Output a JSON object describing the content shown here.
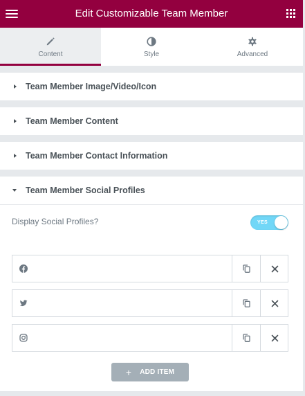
{
  "header": {
    "title": "Edit Customizable Team Member",
    "menu_icon": "hamburger-menu-icon",
    "apps_icon": "grid-apps-icon"
  },
  "tabs": [
    {
      "label": "Content",
      "icon": "pencil-icon",
      "active": true
    },
    {
      "label": "Style",
      "icon": "half-circle-icon",
      "active": false
    },
    {
      "label": "Advanced",
      "icon": "gear-icon",
      "active": false
    }
  ],
  "sections": [
    {
      "title": "Team Member Image/Video/Icon",
      "expanded": false
    },
    {
      "title": "Team Member Content",
      "expanded": false
    },
    {
      "title": "Team Member Contact Information",
      "expanded": false
    },
    {
      "title": "Team Member Social Profiles",
      "expanded": true
    }
  ],
  "social": {
    "display_label": "Display Social Profiles?",
    "toggle_text": "YES",
    "toggle_on": true,
    "items": [
      {
        "icon": "facebook-icon"
      },
      {
        "icon": "twitter-icon"
      },
      {
        "icon": "instagram-icon"
      }
    ],
    "add_item_label": "ADD ITEM"
  },
  "colors": {
    "header_bg": "#93003f",
    "panel_bg": "#e6e9ec",
    "toggle_on": "#71d7f7",
    "add_button": "#a4afb7",
    "section_title": "#495157"
  }
}
